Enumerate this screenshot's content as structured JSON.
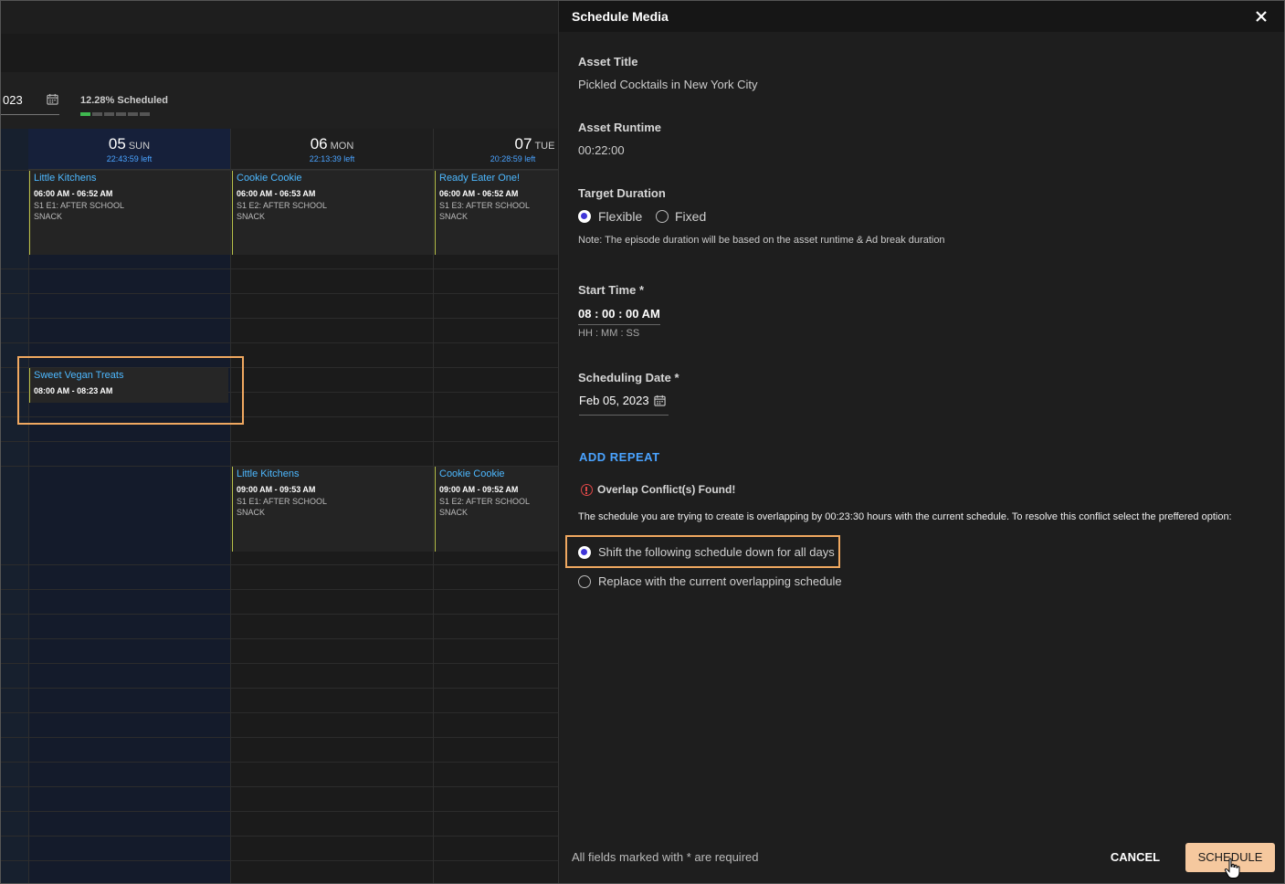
{
  "calendar": {
    "date_fragment": "023",
    "scheduled_percent": "12.28% Scheduled",
    "scheduled_progress": 0.1228,
    "days": [
      {
        "num": "05",
        "dow": "SUN",
        "left": "22:43:59 left"
      },
      {
        "num": "06",
        "dow": "MON",
        "left": "22:13:39 left"
      },
      {
        "num": "07",
        "dow": "TUE",
        "left": "20:28:59 left"
      }
    ],
    "events": [
      {
        "title": "Little Kitchens",
        "time": "06:00 AM - 06:52 AM",
        "line1": "S1 E1: AFTER SCHOOL",
        "line2": "SNACK"
      },
      {
        "title": "Cookie Cookie",
        "time": "06:00 AM - 06:53 AM",
        "line1": "S1 E2: AFTER SCHOOL",
        "line2": "SNACK"
      },
      {
        "title": "Ready Eater One!",
        "time": "06:00 AM - 06:52 AM",
        "line1": "S1 E3: AFTER SCHOOL",
        "line2": "SNACK"
      },
      {
        "title": "Sweet Vegan Treats",
        "time": "08:00 AM - 08:23 AM"
      },
      {
        "title": "Little Kitchens",
        "time": "09:00 AM - 09:53 AM",
        "line1": "S1 E1: AFTER SCHOOL",
        "line2": "SNACK"
      },
      {
        "title": "Cookie Cookie",
        "time": "09:00 AM - 09:52 AM",
        "line1": "S1 E2: AFTER SCHOOL",
        "line2": "SNACK"
      }
    ]
  },
  "dialog": {
    "title": "Schedule Media",
    "asset_title_label": "Asset Title",
    "asset_title": "Pickled Cocktails in New York City",
    "asset_runtime_label": "Asset Runtime",
    "asset_runtime": "00:22:00",
    "target_duration_label": "Target Duration",
    "duration_options": [
      "Flexible",
      "Fixed"
    ],
    "duration_selected": "Flexible",
    "duration_note": "Note: The episode duration will be based on the asset runtime & Ad break duration",
    "start_time_label": "Start Time *",
    "start_time": "08 : 00 : 00 AM",
    "start_time_format": "HH : MM : SS",
    "scheduling_date_label": "Scheduling Date *",
    "scheduling_date": "Feb 05, 2023",
    "add_repeat": "ADD REPEAT",
    "conflict_title": "Overlap Conflict(s) Found!",
    "conflict_message": "The schedule you are trying to create is overlapping by 00:23:30 hours with the current schedule. To resolve this conflict select the preffered option:",
    "conflict_options": [
      "Shift the following schedule down for all days",
      "Replace with the current overlapping schedule"
    ],
    "conflict_selected": "Shift the following schedule down for all days",
    "required_note": "All fields marked with * are required",
    "cancel": "CANCEL",
    "schedule": "SCHEDULE"
  },
  "colors": {
    "accent": "#4aa3ff",
    "highlight": "#f0a860",
    "primary_button": "#f5c89e",
    "radio_selected": "#3f35d8",
    "progress": "#3fb950"
  },
  "icons": [
    "calendar-icon",
    "close-icon",
    "warning-icon",
    "hand-cursor-icon"
  ]
}
